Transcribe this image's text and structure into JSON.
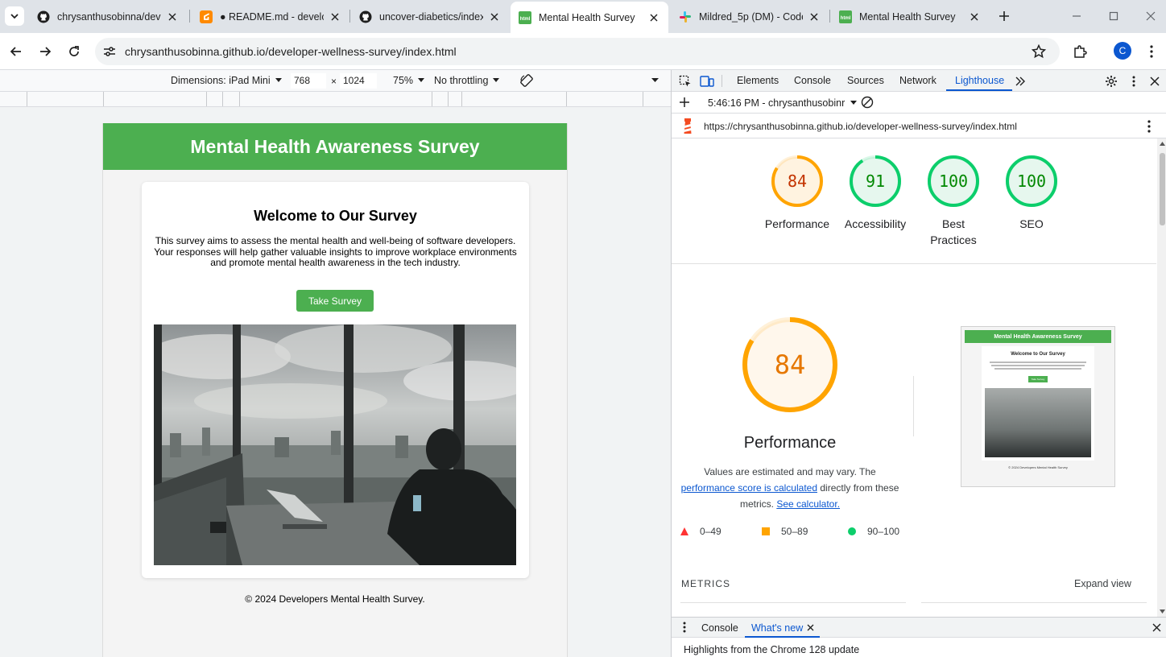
{
  "browser": {
    "tabs": [
      {
        "title": "chrysanthusobinna/deve",
        "favicon": "github-icon"
      },
      {
        "title": "● README.md - develop",
        "favicon": "gitpod-icon"
      },
      {
        "title": "uncover-diabetics/index",
        "favicon": "github-icon"
      },
      {
        "title": "Mental Health Survey",
        "favicon": "html-icon",
        "active": true
      },
      {
        "title": "Mildred_5p (DM) - Code",
        "favicon": "slack-icon"
      },
      {
        "title": "Mental Health Survey",
        "favicon": "html-icon"
      }
    ],
    "url": "chrysanthusobinna.github.io/developer-wellness-survey/index.html",
    "profile_initial": "C",
    "accent": "#0b57d0"
  },
  "emulation": {
    "dimensions_label": "Dimensions: iPad Mini",
    "width": "768",
    "height": "1024",
    "zoom": "75%",
    "throttling": "No throttling"
  },
  "page": {
    "header": "Mental Health Awareness Survey",
    "welcome_title": "Welcome to Our Survey",
    "intro": "This survey aims to assess the mental health and well-being of software developers. Your responses will help gather valuable insights to improve workplace environments and promote mental health awareness in the tech industry.",
    "button": "Take Survey",
    "footer": "© 2024 Developers Mental Health Survey.",
    "brand_color": "#4caf50"
  },
  "devtools": {
    "tabs": [
      "Elements",
      "Console",
      "Sources",
      "Network",
      "Lighthouse"
    ],
    "active_tab": "Lighthouse",
    "report_time": "5:46:16 PM - chrysanthusobinr",
    "report_url": "https://chrysanthusobinna.github.io/developer-wellness-survey/index.html",
    "scores": [
      {
        "label": "Performance",
        "value": "84",
        "color": "#ffa400"
      },
      {
        "label": "Accessibility",
        "value": "91",
        "color": "#0cce6b"
      },
      {
        "label": "Best Practices",
        "value": "100",
        "color": "#0cce6b"
      },
      {
        "label": "SEO",
        "value": "100",
        "color": "#0cce6b"
      }
    ],
    "perf_title": "Performance",
    "perf_desc_1": "Values are estimated and may vary. The",
    "perf_link_1": "performance score is calculated",
    "perf_desc_2": "directly from these metrics.",
    "perf_link_2": "See calculator.",
    "legend": [
      "0–49",
      "50–89",
      "90–100"
    ],
    "metrics_label": "METRICS",
    "expand_label": "Expand view",
    "drawer_tabs": [
      "Console",
      "What's new"
    ],
    "drawer_text": "Highlights from the Chrome 128 update",
    "thumb": {
      "header": "Mental Health Awareness Survey",
      "title": "Welcome to Our Survey",
      "button": "Take Survey",
      "footer": "© 2024 Developers Mental Health Survey"
    }
  }
}
